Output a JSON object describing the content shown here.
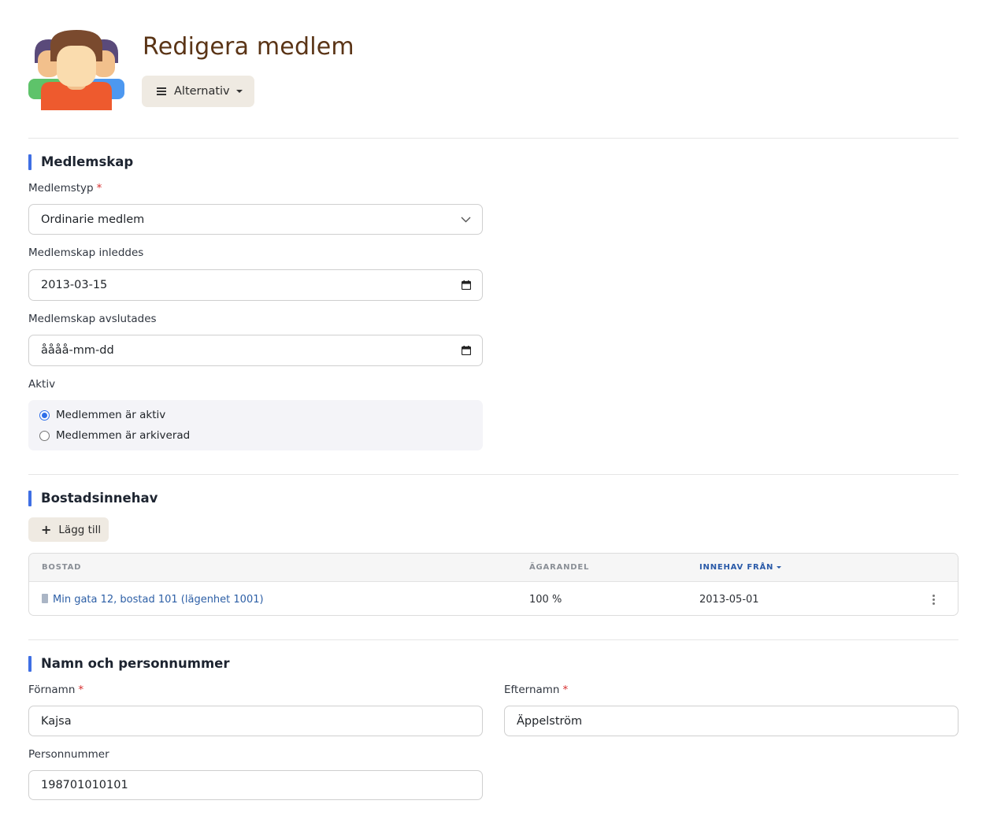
{
  "header": {
    "title": "Redigera medlem",
    "options_label": "Alternativ"
  },
  "membership": {
    "section_title": "Medlemskap",
    "type_label": "Medlemstyp",
    "type_value": "Ordinarie medlem",
    "start_label": "Medlemskap inleddes",
    "start_value": "2013-03-15",
    "end_label": "Medlemskap avslutades",
    "end_placeholder": "åååå-mm-dd",
    "active_label": "Aktiv",
    "radio_active": "Medlemmen är aktiv",
    "radio_archived": "Medlemmen är arkiverad",
    "selected": "active"
  },
  "housing": {
    "section_title": "Bostadsinnehav",
    "add_label": "Lägg till",
    "columns": [
      "BOSTAD",
      "ÄGARANDEL",
      "INNEHAV FRÅN"
    ],
    "rows": [
      {
        "bostad": "Min gata 12, bostad 101 (lägenhet 1001)",
        "agarandel": "100 %",
        "innehav_fran": "2013-05-01"
      }
    ]
  },
  "person": {
    "section_title": "Namn och personnummer",
    "first_name_label": "Förnamn",
    "first_name_value": "Kajsa",
    "last_name_label": "Efternamn",
    "last_name_value": "Äppelström",
    "pnr_label": "Personnummer",
    "pnr_value": "198701010101"
  },
  "required_mark": "*",
  "colors": {
    "title": "#5a3416",
    "accent": "#3f6fe4",
    "link": "#2d5fa6",
    "required": "#d62e2e",
    "button_bg": "#efeae2"
  },
  "icons": {
    "avatar": "members-group-icon",
    "menu": "hamburger-icon",
    "add": "plus-icon",
    "select": "chevron-down-icon",
    "date": "calendar-icon",
    "row_menu": "kebab-icon",
    "building": "building-icon"
  }
}
